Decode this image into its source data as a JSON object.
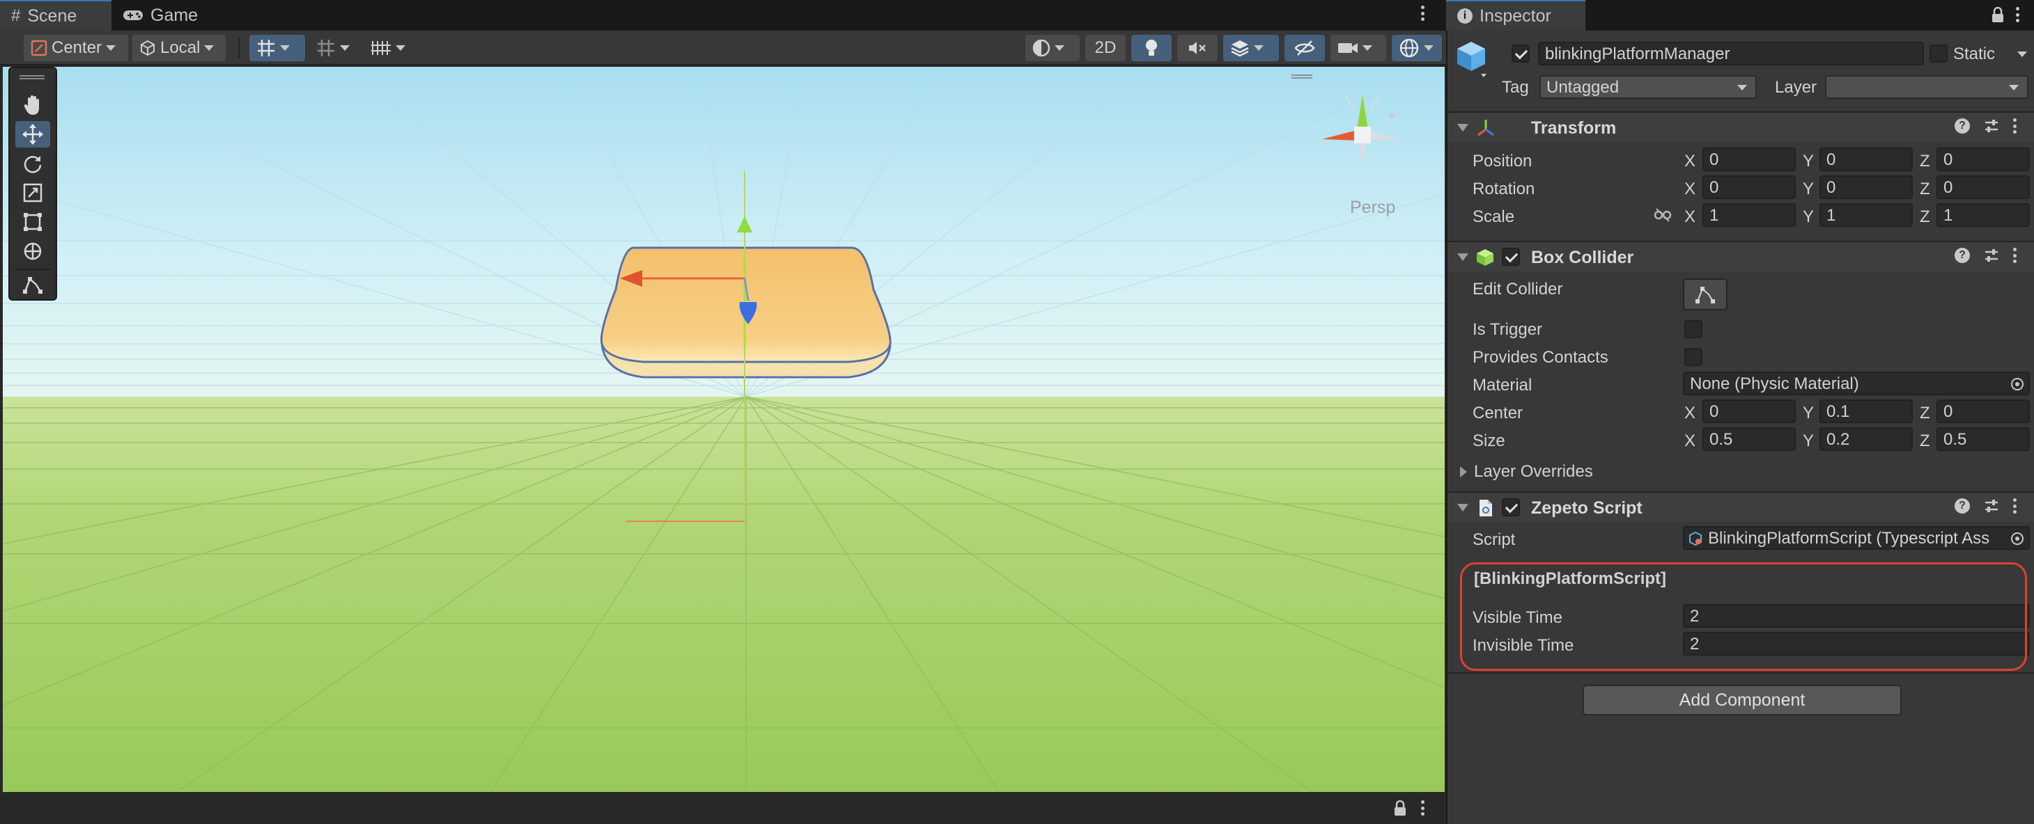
{
  "scene": {
    "tabs": [
      {
        "label": "Scene",
        "active": true
      },
      {
        "label": "Game",
        "active": false
      }
    ],
    "toolbar": {
      "pivot_mode": "Center",
      "pivot_rotation": "Local",
      "mode_2d": "2D"
    },
    "gizmo": {
      "projection_label": "Persp"
    },
    "colors": {
      "accent": "#46607c",
      "sky": "#c6ecf5",
      "ground": "#a9d16f",
      "platform": "#f5c572"
    }
  },
  "inspector": {
    "tab_label": "Inspector",
    "object": {
      "active": true,
      "name": "blinkingPlatformManager",
      "static_label": "Static",
      "static": false,
      "tag_label": "Tag",
      "tag_value": "Untagged",
      "layer_label": "Layer",
      "layer_value": ""
    },
    "transform": {
      "title": "Transform",
      "position_label": "Position",
      "rotation_label": "Rotation",
      "scale_label": "Scale",
      "position": {
        "x": "0",
        "y": "0",
        "z": "0"
      },
      "rotation": {
        "x": "0",
        "y": "0",
        "z": "0"
      },
      "scale": {
        "x": "1",
        "y": "1",
        "z": "1"
      }
    },
    "box_collider": {
      "title": "Box Collider",
      "enabled": true,
      "edit_collider_label": "Edit Collider",
      "is_trigger_label": "Is Trigger",
      "is_trigger": false,
      "provides_contacts_label": "Provides Contacts",
      "provides_contacts": false,
      "material_label": "Material",
      "material_value": "None (Physic Material)",
      "center_label": "Center",
      "center": {
        "x": "0",
        "y": "0.1",
        "z": "0"
      },
      "size_label": "Size",
      "size": {
        "x": "0.5",
        "y": "0.2",
        "z": "0.5"
      },
      "layer_overrides_label": "Layer Overrides"
    },
    "zepeto_script": {
      "title": "Zepeto Script",
      "enabled": true,
      "script_label": "Script",
      "script_value": "BlinkingPlatformScript (Typescript Ass",
      "section_header": "[BlinkingPlatformScript]",
      "visible_time_label": "Visible Time",
      "visible_time": "2",
      "invisible_time_label": "Invisible Time",
      "invisible_time": "2"
    },
    "axis_labels": {
      "x": "X",
      "y": "Y",
      "z": "Z"
    },
    "add_component_label": "Add Component",
    "highlight_color": "#e2402e"
  }
}
